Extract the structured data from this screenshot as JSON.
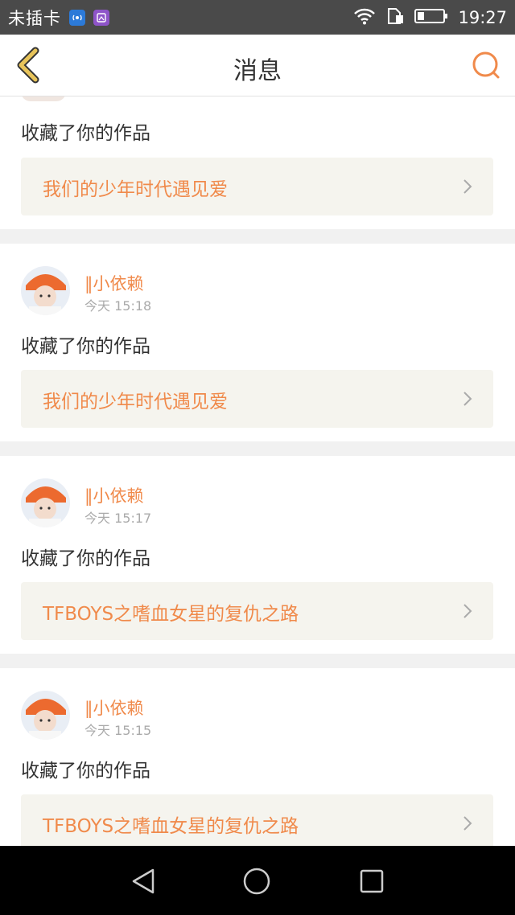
{
  "status_bar": {
    "carrier": "未插卡",
    "time": "19:27",
    "icons": [
      "wifi-hotspot-app-icon",
      "gallery-app-icon",
      "wifi-icon",
      "sim-icon",
      "battery-icon"
    ]
  },
  "header": {
    "title": "消息",
    "back_icon": "chevron-left-icon",
    "search_icon": "search-icon"
  },
  "messages": [
    {
      "action": "收藏了你的作品",
      "work_title": "我们的少年时代遇见爱"
    },
    {
      "user": "‖小依赖",
      "time": "今天 15:18",
      "action": "收藏了你的作品",
      "work_title": "我们的少年时代遇见爱"
    },
    {
      "user": "‖小依赖",
      "time": "今天 15:17",
      "action": "收藏了你的作品",
      "work_title": "TFBOYS之嗜血女星的复仇之路"
    },
    {
      "user": "‖小依赖",
      "time": "今天 15:15",
      "action": "收藏了你的作品",
      "work_title": "TFBOYS之嗜血女星的复仇之路"
    }
  ],
  "colors": {
    "accent": "#f08a4b",
    "back_icon": "#e8c45a",
    "status_bar": "#4a4a4a",
    "work_bg": "#f5f4ee"
  },
  "system_nav": [
    "back-triangle-icon",
    "home-circle-icon",
    "recents-square-icon"
  ]
}
